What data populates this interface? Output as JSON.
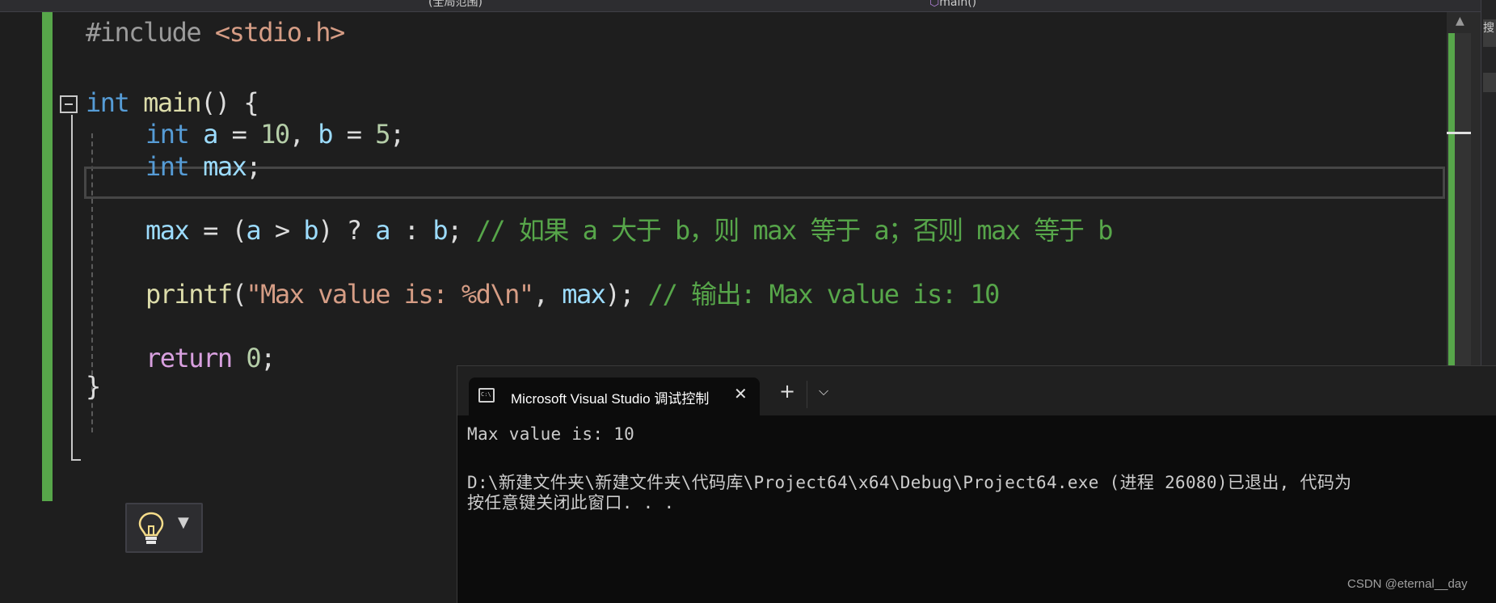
{
  "toolbar": {
    "scope_dropdown": "(全局范围)",
    "member_dropdown": "main()"
  },
  "code": {
    "l1": {
      "include": "#include ",
      "header": "<stdio.h>"
    },
    "l3": {
      "type": "int",
      "name": "main",
      "tail": "() {"
    },
    "l4": {
      "type": "int",
      "a": "a",
      "eq1": " = ",
      "ten": "10",
      "comma": ", ",
      "b": "b",
      "eq2": " = ",
      "five": "5",
      "semi": ";"
    },
    "l5": {
      "type": "int",
      "max": "max",
      "semi": ";"
    },
    "l7": {
      "max": "max",
      "ops1": " = (",
      "a": "a",
      "gt": " > ",
      "b": "b",
      "ops2": ") ? ",
      "a2": "a",
      "colon": " : ",
      "b2": "b",
      "semi": "; ",
      "comment": "// 如果 a 大于 b，则 max 等于 a；否则 max 等于 b"
    },
    "l9": {
      "fn": "printf",
      "open": "(",
      "str": "\"Max value is: %d\\n\"",
      "comma": ", ",
      "max": "max",
      "close": "); ",
      "comment": "// 输出: Max value is: 10"
    },
    "l11": {
      "kw": "return",
      "sp": " ",
      "zero": "0",
      "semi": ";"
    },
    "l12": {
      "brace": "}"
    }
  },
  "console": {
    "tab_title": "Microsoft Visual Studio 调试控制台",
    "close_glyph": "✕",
    "new_tab_glyph": "+",
    "dropdown_glyph": "⌵",
    "output": [
      "Max value is: 10",
      "",
      "D:\\新建文件夹\\新建文件夹\\代码库\\Project64\\x64\\Debug\\Project64.exe (进程 26080)已退出, 代码为",
      "按任意键关闭此窗口. . ."
    ]
  },
  "right_panel": {
    "tab_glyph": "搜"
  },
  "watermark": "CSDN @eternal__day",
  "colors": {
    "editor_bg": "#1e1e1e",
    "keyword": "#569cd6",
    "function": "#dcdcaa",
    "variable": "#9cdcfe",
    "number": "#b5cea8",
    "string": "#d69d85",
    "comment": "#57a64a",
    "control": "#d8a0df",
    "console_bg": "#0c0c0c"
  },
  "icons": [
    "collapse-minus-icon",
    "lightbulb-icon",
    "terminal-icon",
    "close-icon",
    "plus-icon",
    "chevron-down-icon"
  ]
}
